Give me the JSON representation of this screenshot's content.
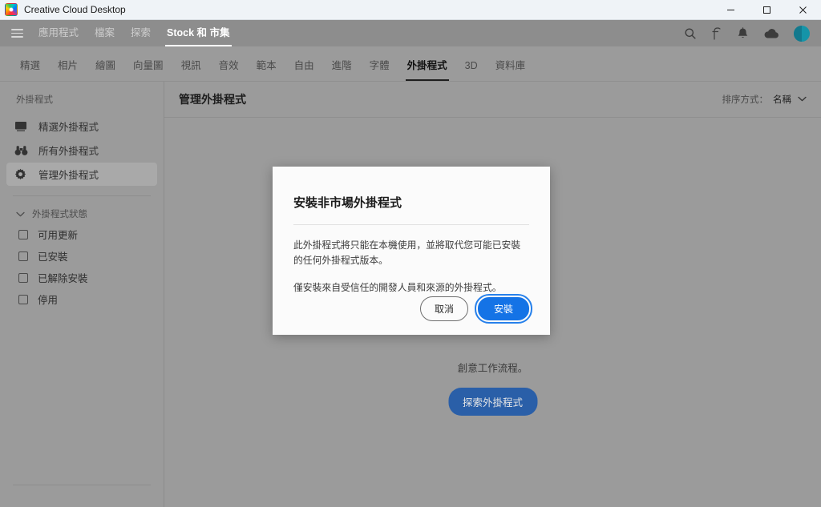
{
  "window": {
    "title": "Creative Cloud Desktop",
    "app_icon": "creative-cloud-icon",
    "minimize_label": "—",
    "maximize_label": "□",
    "close_label": "✕"
  },
  "topnav": {
    "menu_icon": "hamburger-menu-icon",
    "items": [
      {
        "label": "應用程式",
        "active": false
      },
      {
        "label": "檔案",
        "active": false
      },
      {
        "label": "探索",
        "active": false
      },
      {
        "label": "Stock 和 市集",
        "active": true
      }
    ],
    "icons": [
      {
        "name": "search-icon"
      },
      {
        "name": "fonts-icon"
      },
      {
        "name": "notifications-bell-icon"
      },
      {
        "name": "cloud-sync-icon"
      },
      {
        "name": "user-avatar"
      }
    ]
  },
  "category_tabs": [
    {
      "label": "精選",
      "active": false
    },
    {
      "label": "相片",
      "active": false
    },
    {
      "label": "繪圖",
      "active": false
    },
    {
      "label": "向量圖",
      "active": false
    },
    {
      "label": "視訊",
      "active": false
    },
    {
      "label": "音效",
      "active": false
    },
    {
      "label": "範本",
      "active": false
    },
    {
      "label": "自由",
      "active": false
    },
    {
      "label": "進階",
      "active": false
    },
    {
      "label": "字體",
      "active": false
    },
    {
      "label": "外掛程式",
      "active": true
    },
    {
      "label": "3D",
      "active": false
    },
    {
      "label": "資料庫",
      "active": false
    }
  ],
  "sidebar": {
    "header": "外掛程式",
    "items": [
      {
        "label": "精選外掛程式",
        "icon": "monitor-icon",
        "selected": false
      },
      {
        "label": "所有外掛程式",
        "icon": "binoculars-icon",
        "selected": false
      },
      {
        "label": "管理外掛程式",
        "icon": "gear-icon",
        "selected": true
      }
    ],
    "group": {
      "label": "外掛程式狀態",
      "expanded": true,
      "chevron_icon": "chevron-down-icon",
      "options": [
        {
          "label": "可用更新",
          "checked": false
        },
        {
          "label": "已安裝",
          "checked": false
        },
        {
          "label": "已解除安裝",
          "checked": false
        },
        {
          "label": "停用",
          "checked": false
        }
      ]
    }
  },
  "main": {
    "title": "管理外掛程式",
    "sort": {
      "label": "排序方式：",
      "value": "名稱",
      "chevron_icon": "chevron-down-icon"
    },
    "empty_state": {
      "text": "創意工作流程。",
      "button_label": "探索外掛程式"
    }
  },
  "dialog": {
    "title": "安裝非市場外掛程式",
    "paragraph1": "此外掛程式將只能在本機使用，並將取代您可能已安裝的任何外掛程式版本。",
    "paragraph2": "僅安裝來自受信任的開發人員和來源的外掛程式。",
    "cancel_label": "取消",
    "install_label": "安裝"
  },
  "colors": {
    "accent_blue": "#1473e6",
    "focus_ring": "#2680eb",
    "explore_button": "#2a5fa8",
    "titlebar_bg": "#eff3f7",
    "chrome_bg": "#9b9b9b",
    "nav_bg": "#8d8d8d",
    "avatar": "#1594a8"
  }
}
